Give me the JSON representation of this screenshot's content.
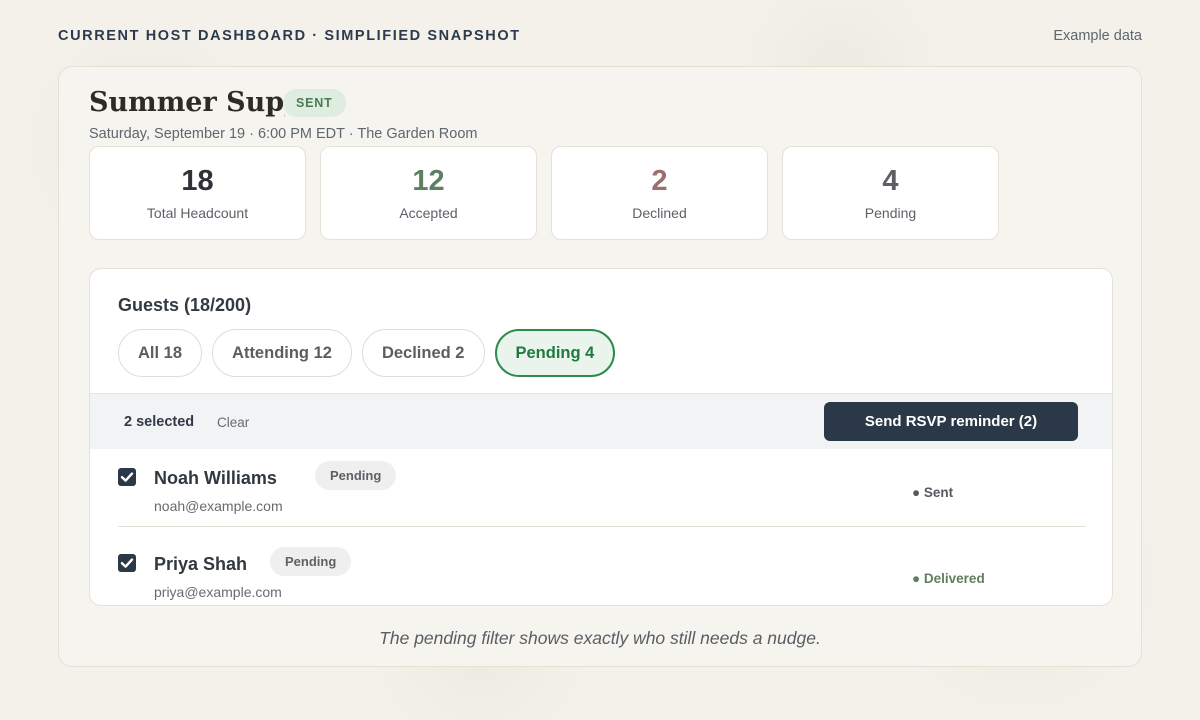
{
  "header": {
    "kicker": "CURRENT HOST DASHBOARD · SIMPLIFIED SNAPSHOT",
    "example_label": "Example data"
  },
  "event": {
    "title": "Summer Supper",
    "status": "SENT",
    "meta": "Saturday, September 19 · 6:00 PM EDT · The Garden Room"
  },
  "stats": [
    {
      "value": "18",
      "label": "Total Headcount",
      "color": "#2f3236"
    },
    {
      "value": "12",
      "label": "Accepted",
      "color": "#5c8062"
    },
    {
      "value": "2",
      "label": "Declined",
      "color": "#9a6f6c"
    },
    {
      "value": "4",
      "label": "Pending",
      "color": "#5d5f62"
    }
  ],
  "guests": {
    "title": "Guests (18/200)",
    "filters": [
      "All 18",
      "Attending 12",
      "Declined 2",
      "Pending 4"
    ],
    "active_filter": "Pending 4",
    "selection": {
      "count_label": "2 selected",
      "clear_label": "Clear",
      "action_label": "Send RSVP reminder (2)"
    },
    "rows": [
      {
        "name": "Noah Williams",
        "email": "noah@example.com",
        "status": "Pending",
        "delivery": "● Sent",
        "delivery_color": "#555a60",
        "checked": true
      },
      {
        "name": "Priya Shah",
        "email": "priya@example.com",
        "status": "Pending",
        "delivery": "● Delivered",
        "delivery_color": "#5e7f5e",
        "checked": true
      }
    ]
  },
  "caption": "The pending filter shows exactly who still needs a nudge."
}
